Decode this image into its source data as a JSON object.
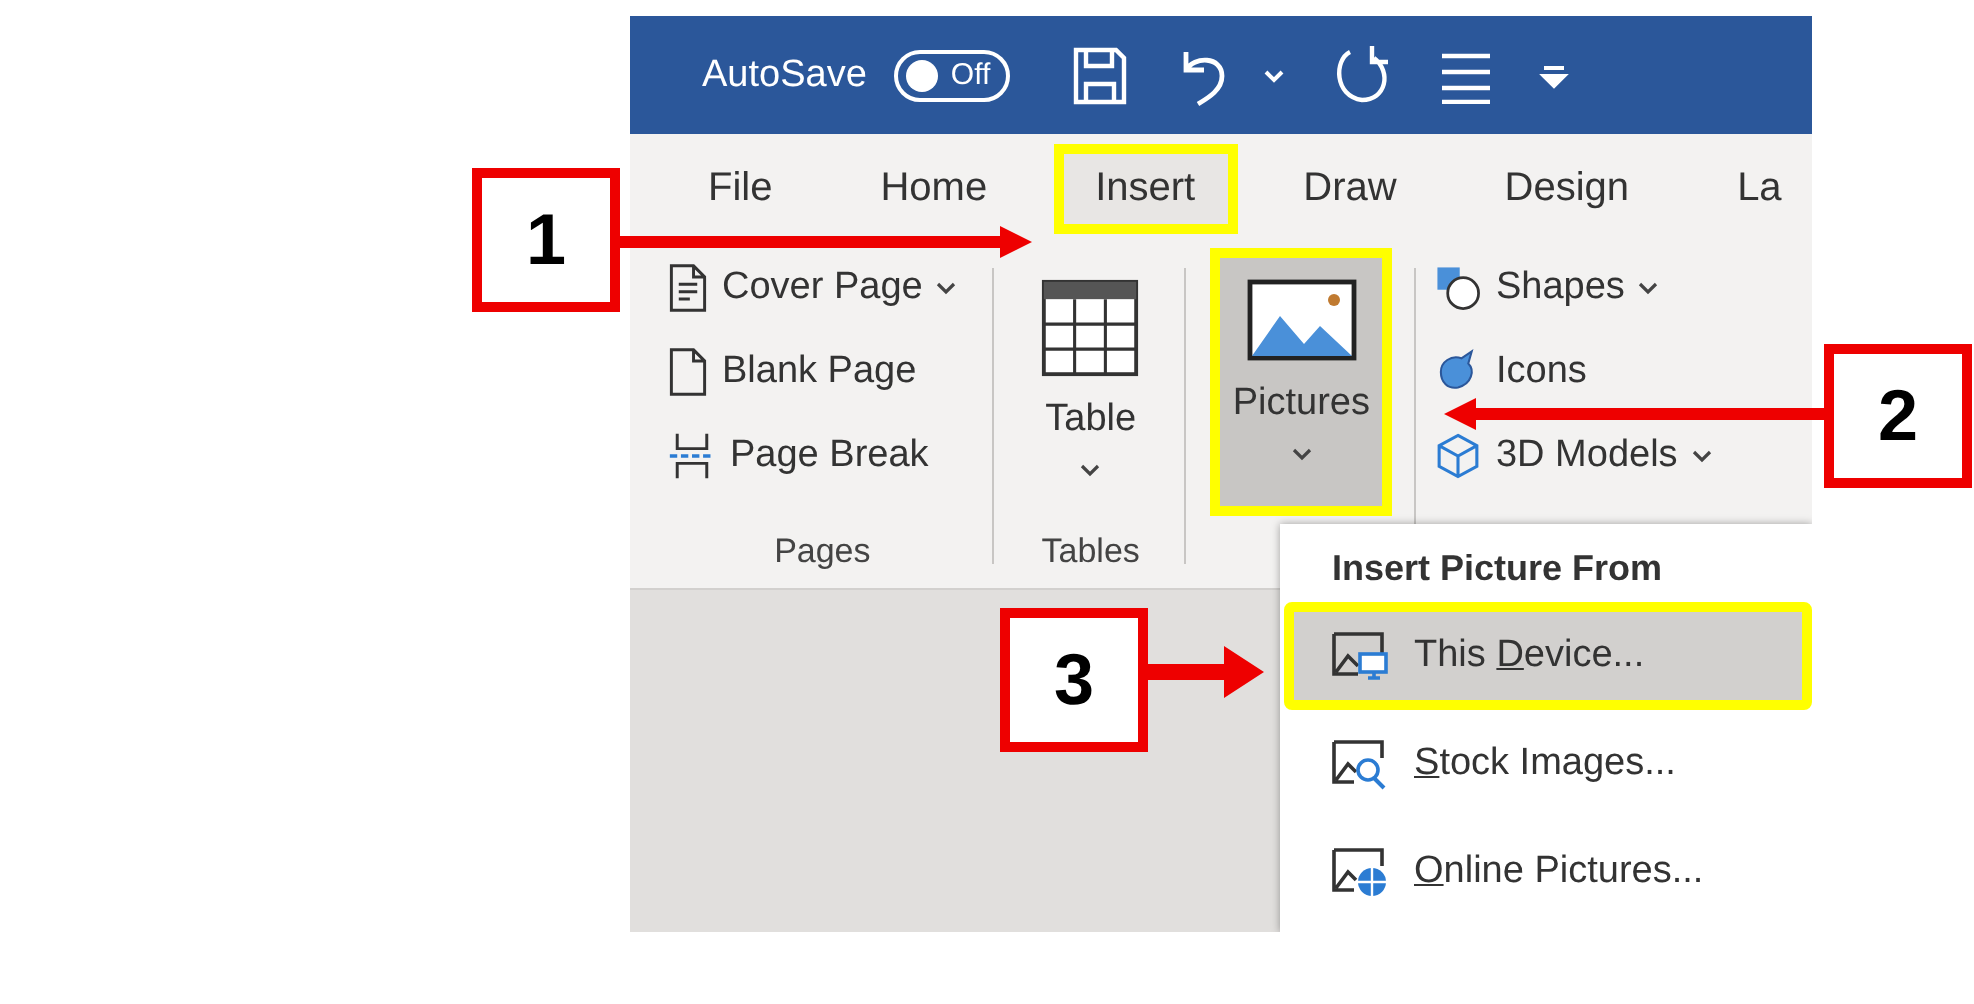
{
  "title_bar": {
    "autosave_label": "AutoSave",
    "autosave_toggle": {
      "label": "Off",
      "on": false
    }
  },
  "tabs": [
    {
      "label": "File",
      "selected": false,
      "highlighted": false
    },
    {
      "label": "Home",
      "selected": false,
      "highlighted": false
    },
    {
      "label": "Insert",
      "selected": true,
      "highlighted": true
    },
    {
      "label": "Draw",
      "selected": false,
      "highlighted": false
    },
    {
      "label": "Design",
      "selected": false,
      "highlighted": false
    },
    {
      "label": "La",
      "selected": false,
      "highlighted": false
    }
  ],
  "ribbon": {
    "groups": [
      {
        "label": "Pages",
        "kind": "list",
        "items": [
          {
            "label": "Cover Page",
            "has_caret": true
          },
          {
            "label": "Blank Page",
            "has_caret": false
          },
          {
            "label": "Page Break",
            "has_caret": false
          }
        ]
      },
      {
        "label": "Tables",
        "kind": "large",
        "items": [
          {
            "label": "Table",
            "has_caret": true,
            "pressed": false,
            "highlighted": false
          }
        ]
      },
      {
        "kind": "large",
        "items": [
          {
            "label": "Pictures",
            "has_caret": true,
            "pressed": true,
            "highlighted": true
          }
        ]
      },
      {
        "kind": "list",
        "items": [
          {
            "label": "Shapes",
            "has_caret": true
          },
          {
            "label": "Icons",
            "has_caret": false
          },
          {
            "label": "3D Models",
            "has_caret": true
          }
        ]
      }
    ]
  },
  "picture_menu": {
    "title": "Insert Picture From",
    "items": [
      {
        "label": {
          "before": "This ",
          "underlined": "D",
          "after": "evice..."
        },
        "selected": true,
        "highlighted": true
      },
      {
        "label": {
          "underlined": "S",
          "after": "tock Images..."
        },
        "selected": false,
        "highlighted": false
      },
      {
        "label": {
          "underlined": "O",
          "after": "nline Pictures..."
        },
        "selected": false,
        "highlighted": false
      }
    ]
  },
  "callouts": [
    {
      "label": "1"
    },
    {
      "label": "2"
    },
    {
      "label": "3"
    }
  ]
}
